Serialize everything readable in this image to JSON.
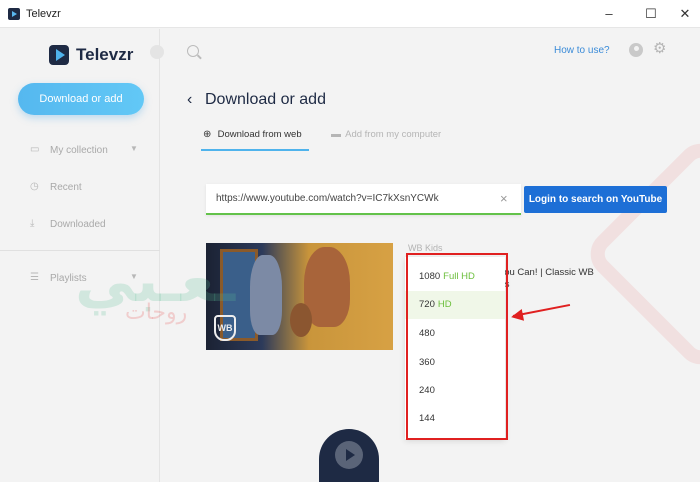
{
  "window": {
    "title": "Televzr",
    "minimize": "–",
    "maximize": "☐",
    "close": "✕"
  },
  "sidebar": {
    "logo_text": "Televzr",
    "primary_button": "Download or add",
    "items": [
      {
        "label": "My collection",
        "icon": "folder-icon",
        "glyph": "▭",
        "chevron": "▼"
      },
      {
        "label": "Recent",
        "icon": "clock-icon",
        "glyph": "◷"
      },
      {
        "label": "Downloaded",
        "icon": "download-icon",
        "glyph": "⤓"
      },
      {
        "label": "Playlists",
        "icon": "list-icon",
        "glyph": "☰",
        "chevron": "▼"
      }
    ]
  },
  "header": {
    "how_to_use": "How to use?"
  },
  "main": {
    "title": "Download or add",
    "back": "‹",
    "tabs": [
      {
        "label": "Download from web",
        "icon": "globe-icon",
        "glyph": "⊕",
        "active": true
      },
      {
        "label": "Add from my computer",
        "icon": "folder-icon",
        "glyph": "▬",
        "active": false
      }
    ],
    "url_value": "https://www.youtube.com/watch?v=IC7kXsnYCWk",
    "url_clear": "×",
    "login_button": "Login to search on YouTube",
    "video": {
      "channel": "WB Kids",
      "title": "If You Can! | Classic WB Kids"
    },
    "quality_options": [
      {
        "label": "1080",
        "tag": "Full HD"
      },
      {
        "label": "720",
        "tag": "HD"
      },
      {
        "label": "480",
        "tag": ""
      },
      {
        "label": "360",
        "tag": ""
      },
      {
        "label": "240",
        "tag": ""
      },
      {
        "label": "144",
        "tag": ""
      }
    ]
  },
  "colors": {
    "accent": "#4fb3ec",
    "login_button": "#1d6fd6",
    "annotation": "#e02020",
    "hd_tag": "#6cbf3c"
  }
}
